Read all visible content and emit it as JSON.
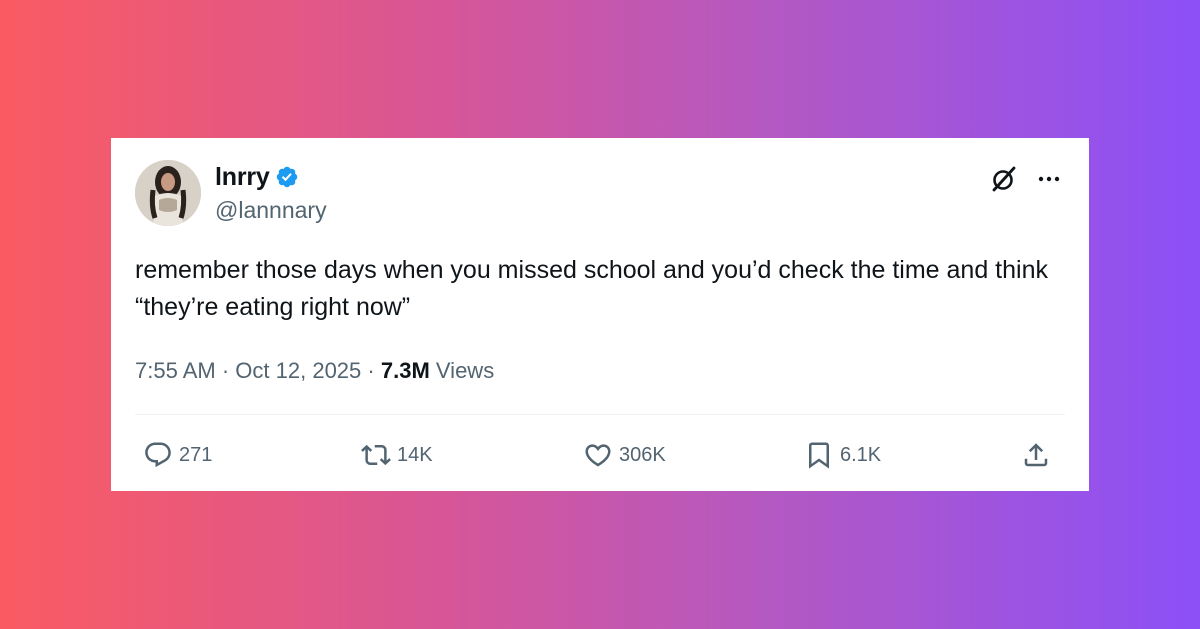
{
  "user": {
    "display_name": "lnrry",
    "handle": "@lannnary",
    "verified": true,
    "verified_color": "#1d9bf0"
  },
  "tweet": {
    "text": "remember those days when you missed school and you’d check the time and think “they’re eating right now”",
    "time": "7:55 AM",
    "separator": "·",
    "date": "Oct 12, 2025",
    "views_count": "7.3M",
    "views_label": "Views"
  },
  "actions": {
    "replies": "271",
    "retweets": "14K",
    "likes": "306K",
    "bookmarks": "6.1K"
  },
  "icons": {
    "header": [
      "grok-icon",
      "more-icon"
    ],
    "actions": [
      "reply-icon",
      "retweet-icon",
      "like-icon",
      "bookmark-icon",
      "share-icon"
    ]
  },
  "colors": {
    "text_primary": "#0f1419",
    "text_secondary": "#536471",
    "background_gradient": [
      "#fa5b62",
      "#8c50f7"
    ]
  }
}
